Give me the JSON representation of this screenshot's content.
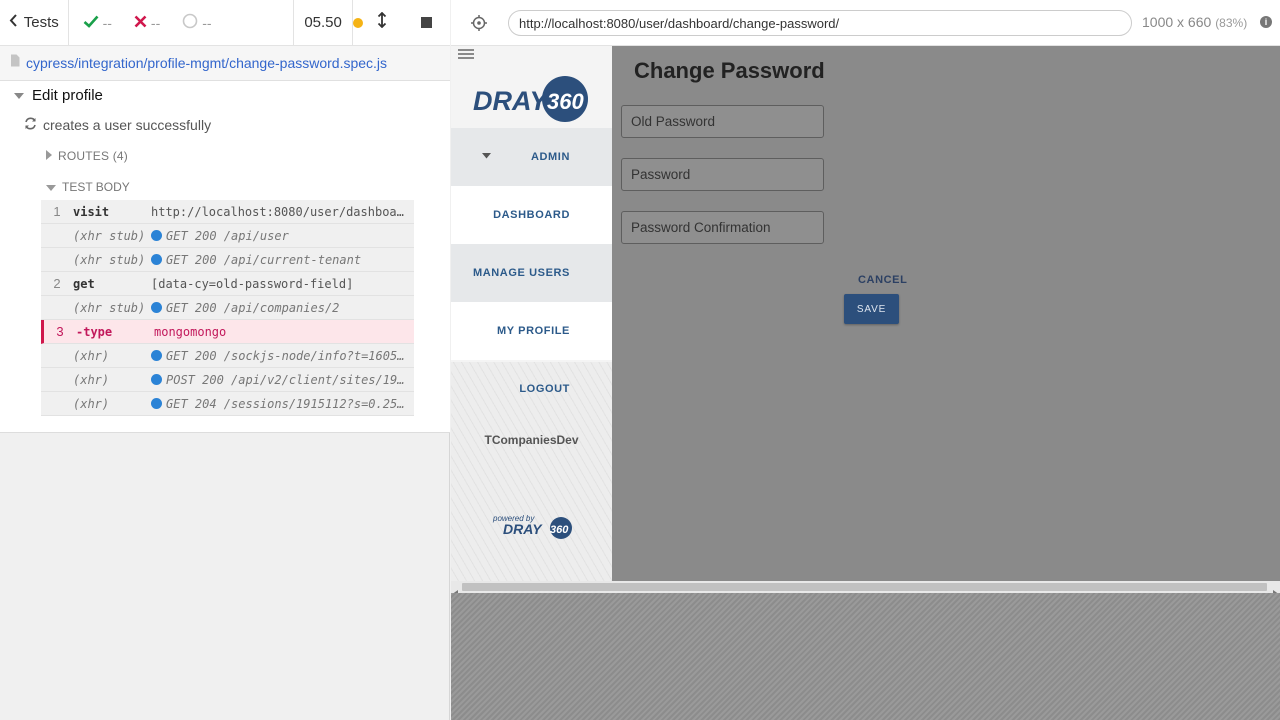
{
  "top_bar": {
    "tests_label": "Tests",
    "passed": "--",
    "failed": "--",
    "pending": "--",
    "timer": "05.50"
  },
  "spec": {
    "path": "cypress/integration/profile-mgmt/change-password.spec.js"
  },
  "reporter": {
    "suite": "Edit profile",
    "test": "creates a user successfully",
    "routes_label": "ROUTES (4)",
    "test_body_label": "TEST BODY",
    "commands": [
      {
        "num": "1",
        "name": "visit",
        "msg": "http://localhost:8080/user/dashboa…",
        "kind": "normal"
      },
      {
        "num": "",
        "name": "(xhr stub)",
        "msg": "GET 200 /api/user",
        "kind": "xhr"
      },
      {
        "num": "",
        "name": "(xhr stub)",
        "msg": "GET 200 /api/current-tenant",
        "kind": "xhr"
      },
      {
        "num": "2",
        "name": "get",
        "msg": "[data-cy=old-password-field]",
        "kind": "normal"
      },
      {
        "num": "",
        "name": "(xhr stub)",
        "msg": "GET 200 /api/companies/2",
        "kind": "xhr"
      },
      {
        "num": "3",
        "name": "-type",
        "msg": "mongomongo",
        "kind": "fail"
      },
      {
        "num": "",
        "name": "(xhr)",
        "msg": "GET 200 /sockjs-node/info?t=1605…",
        "kind": "xhr"
      },
      {
        "num": "",
        "name": "(xhr)",
        "msg": "POST 200 /api/v2/client/sites/19…",
        "kind": "xhr"
      },
      {
        "num": "",
        "name": "(xhr)",
        "msg": "GET 204 /sessions/1915112?s=0.25…",
        "kind": "xhr"
      }
    ]
  },
  "browser": {
    "url": "http://localhost:8080/user/dashboard/change-password/",
    "viewport": "1000 x 660",
    "scale": "(83%)"
  },
  "app": {
    "logo_text": "DRAY360",
    "nav": [
      "ADMIN",
      "DASHBOARD",
      "MANAGE USERS",
      "MY PROFILE",
      "LOGOUT"
    ],
    "company": "TCompaniesDev",
    "powered_by": "powered by",
    "powered_logo": "DRAY360",
    "page_title": "Change Password",
    "fields": {
      "old_password": "Old Password",
      "password": "Password",
      "password_confirmation": "Password Confirmation"
    },
    "cancel_label": "CANCEL",
    "save_label": "SAVE"
  },
  "colors": {
    "pass": "#1aa04a",
    "fail": "#d0174c",
    "accent_blue": "#2c5a8a",
    "running_dot": "#f5b315"
  }
}
